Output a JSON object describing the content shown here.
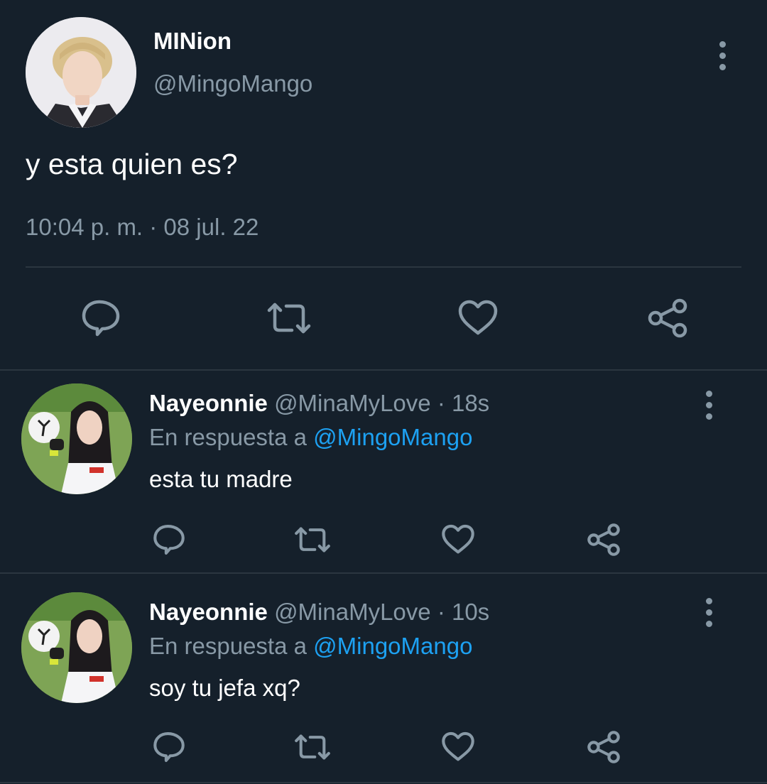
{
  "main_tweet": {
    "display_name": "MINion",
    "handle": "@MingoMango",
    "text": "y esta quien es?",
    "timestamp": "10:04 p. m. · 08 jul. 22",
    "avatar_icon": "person-photo-avatar",
    "actions": [
      "reply-icon",
      "retweet-icon",
      "like-icon",
      "share-icon"
    ]
  },
  "replies": [
    {
      "display_name": "Nayeonnie",
      "handle": "@MinaMyLove",
      "time": "· 18s",
      "reply_prefix": "En respuesta a",
      "reply_to": "@MingoMango",
      "text": "esta tu madre"
    },
    {
      "display_name": "Nayeonnie",
      "handle": "@MinaMyLove",
      "time": "· 10s",
      "reply_prefix": "En respuesta a",
      "reply_to": "@MingoMango",
      "text": "soy tu jefa xq?"
    }
  ],
  "colors": {
    "background": "#15202b",
    "text": "#ffffff",
    "muted": "#8899a6",
    "link": "#1da1f2",
    "divider": "#2b3640"
  }
}
